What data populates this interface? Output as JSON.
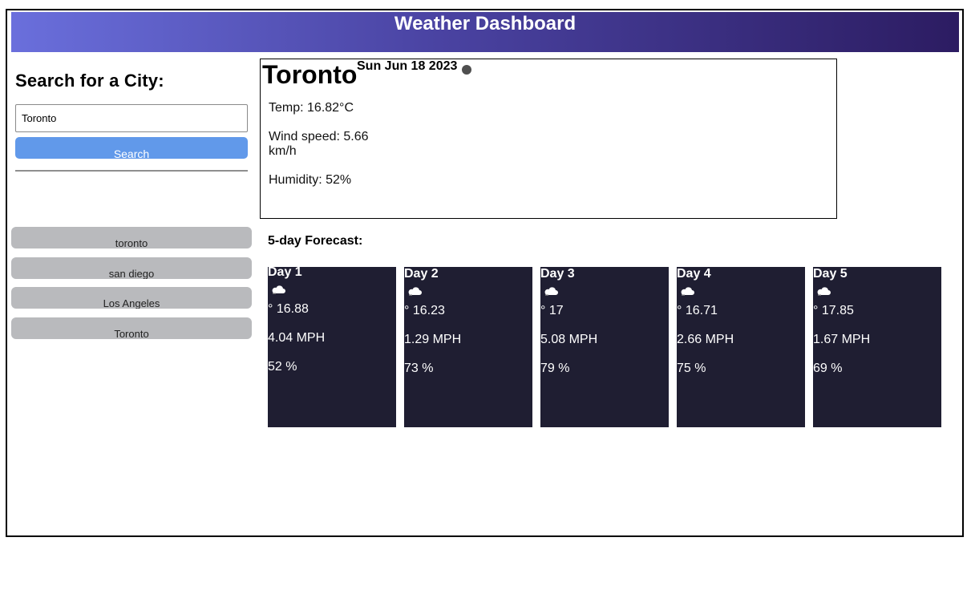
{
  "header": {
    "title": "Weather Dashboard"
  },
  "sidebar": {
    "heading": "Search for a City:",
    "search_value": "Toronto",
    "search_button_label": "Search",
    "history": [
      {
        "label": "toronto"
      },
      {
        "label": "san diego"
      },
      {
        "label": "Los Angeles"
      },
      {
        "label": "Toronto"
      }
    ]
  },
  "current": {
    "city": "Toronto",
    "date": "Sun Jun 18 2023",
    "temp": "Temp: 16.82°C",
    "wind": "Wind speed: 5.66 km/h",
    "humidity": "Humidity: 52%",
    "icon": "weather-dot-icon"
  },
  "forecast": {
    "heading": "5-day Forecast:",
    "days": [
      {
        "title": "Day 1",
        "icon": "cloud-icon",
        "temp": "° 16.88",
        "wind": "4.04 MPH",
        "humidity": "52 %"
      },
      {
        "title": "Day 2",
        "icon": "cloud-icon",
        "temp": "° 16.23",
        "wind": "1.29 MPH",
        "humidity": "73 %"
      },
      {
        "title": "Day 3",
        "icon": "cloud-icon",
        "temp": "° 17",
        "wind": "5.08 MPH",
        "humidity": "79 %"
      },
      {
        "title": "Day 4",
        "icon": "cloud-icon",
        "temp": "° 16.71",
        "wind": "2.66 MPH",
        "humidity": "75 %"
      },
      {
        "title": "Day 5",
        "icon": "cloud-icon",
        "temp": "° 17.85",
        "wind": "1.67 MPH",
        "humidity": "69 %"
      }
    ]
  },
  "colors": {
    "header_gradient_start": "#6a6fdc",
    "header_gradient_end": "#2c1c62",
    "search_button": "#6199ea",
    "history_button": "#b9babd",
    "forecast_card": "#1f1e32"
  }
}
